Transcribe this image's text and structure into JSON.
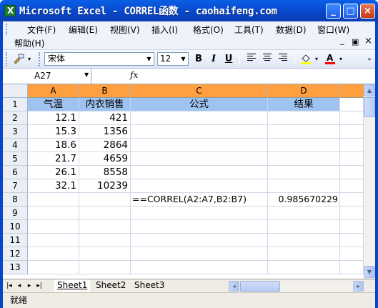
{
  "window": {
    "title": "Microsoft Excel - CORREL函数 - caohaifeng.com",
    "minimize": "_",
    "maximize": "□",
    "close": "×"
  },
  "menu": {
    "items": [
      "文件(F)",
      "编辑(E)",
      "视图(V)",
      "插入(I)",
      "格式(O)",
      "工具(T)",
      "数据(D)",
      "窗口(W)"
    ],
    "help": "帮助(H)",
    "mdi_minimize": "_",
    "mdi_restore": "▣",
    "mdi_close": "×"
  },
  "toolbar": {
    "font": "宋体",
    "size": "12",
    "bold": "B",
    "italic": "I",
    "underline": "U",
    "fill_color": "#ffff00",
    "font_color": "#ff0000"
  },
  "formula_bar": {
    "name_box": "A27",
    "fx": "fx",
    "content": ""
  },
  "sheet": {
    "columns": [
      "A",
      "B",
      "C",
      "D"
    ],
    "rows": [
      {
        "n": "1",
        "a": "气温",
        "b": "内衣销售",
        "c": "公式",
        "d": "结果"
      },
      {
        "n": "2",
        "a": "12.1",
        "b": "421",
        "c": "",
        "d": ""
      },
      {
        "n": "3",
        "a": "15.3",
        "b": "1356",
        "c": "",
        "d": ""
      },
      {
        "n": "4",
        "a": "18.6",
        "b": "2864",
        "c": "",
        "d": ""
      },
      {
        "n": "5",
        "a": "21.7",
        "b": "4659",
        "c": "",
        "d": ""
      },
      {
        "n": "6",
        "a": "26.1",
        "b": "8558",
        "c": "",
        "d": ""
      },
      {
        "n": "7",
        "a": "32.1",
        "b": "10239",
        "c": "",
        "d": ""
      },
      {
        "n": "8",
        "a": "",
        "b": "",
        "c": "==CORREL(A2:A7,B2:B7)",
        "d": "0.985670229"
      },
      {
        "n": "9",
        "a": "",
        "b": "",
        "c": "",
        "d": ""
      },
      {
        "n": "10",
        "a": "",
        "b": "",
        "c": "",
        "d": ""
      },
      {
        "n": "11",
        "a": "",
        "b": "",
        "c": "",
        "d": ""
      },
      {
        "n": "12",
        "a": "",
        "b": "",
        "c": "",
        "d": ""
      },
      {
        "n": "13",
        "a": "",
        "b": "",
        "c": "",
        "d": ""
      }
    ],
    "header_fill": "#9fc3f0",
    "column_header_fill": "#ff9f40"
  },
  "tabs": [
    "Sheet1",
    "Sheet2",
    "Sheet3"
  ],
  "status": "就绪"
}
